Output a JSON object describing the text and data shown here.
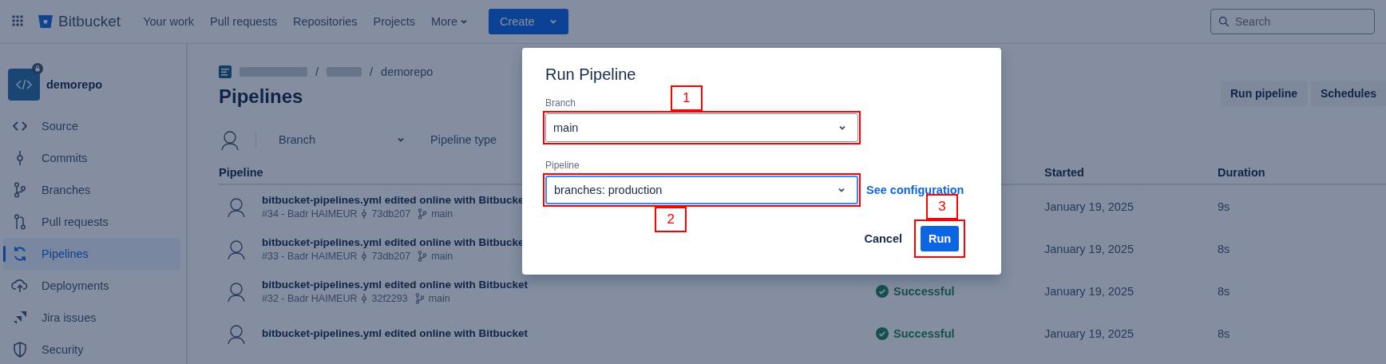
{
  "topbar": {
    "product": "Bitbucket",
    "nav": [
      "Your work",
      "Pull requests",
      "Repositories",
      "Projects"
    ],
    "more": "More",
    "create": "Create",
    "search": {
      "placeholder": "Search"
    }
  },
  "sidebar": {
    "repo": "demorepo",
    "items": [
      {
        "label": "Source",
        "selected": false
      },
      {
        "label": "Commits",
        "selected": false
      },
      {
        "label": "Branches",
        "selected": false
      },
      {
        "label": "Pull requests",
        "selected": false
      },
      {
        "label": "Pipelines",
        "selected": true
      },
      {
        "label": "Deployments",
        "selected": false
      },
      {
        "label": "Jira issues",
        "selected": false
      },
      {
        "label": "Security",
        "selected": false
      }
    ]
  },
  "page": {
    "breadcrumb": {
      "separators": [
        "/",
        "/"
      ],
      "current": "demorepo"
    },
    "title": "Pipelines",
    "actions": [
      "Run pipeline",
      "Schedules"
    ],
    "filters": {
      "branch": "Branch",
      "pipeline_type": "Pipeline type"
    }
  },
  "table": {
    "columns": [
      "Pipeline",
      "Started",
      "Duration"
    ],
    "rows": [
      {
        "title": "bitbucket-pipelines.yml edited online with Bitbucke",
        "meta": {
          "build": "#34 - Badr HAIMEUR",
          "commit": "73db207",
          "branch": "main"
        },
        "started": "January 19, 2025",
        "duration": "9s"
      },
      {
        "title": "bitbucket-pipelines.yml edited online with Bitbucke",
        "meta": {
          "build": "#33 - Badr HAIMEUR",
          "commit": "73db207",
          "branch": "main"
        },
        "started": "January 19, 2025",
        "duration": "8s"
      },
      {
        "title": "bitbucket-pipelines.yml edited online with Bitbucket",
        "meta": {
          "build": "#32 - Badr HAIMEUR",
          "commit": "32f2293",
          "branch": "main"
        },
        "status": {
          "label": "Successful",
          "kind": "success"
        },
        "started": "January 19, 2025",
        "duration": "8s"
      },
      {
        "title": "bitbucket-pipelines.yml edited online with Bitbucket",
        "status": {
          "label": "Successful",
          "kind": "success"
        },
        "started": "January 19, 2025",
        "duration": "8s"
      }
    ]
  },
  "modal": {
    "title": "Run Pipeline",
    "fields": [
      {
        "label": "Branch",
        "value": "main",
        "focused": false,
        "annotation": {
          "label": "1"
        }
      },
      {
        "label": "Pipeline",
        "value": "branches: production",
        "focused": true,
        "annotation": {
          "label": "2"
        }
      }
    ],
    "link": "See configuration",
    "cancel": "Cancel",
    "run": "Run",
    "run_annotation": {
      "label": "3"
    }
  }
}
